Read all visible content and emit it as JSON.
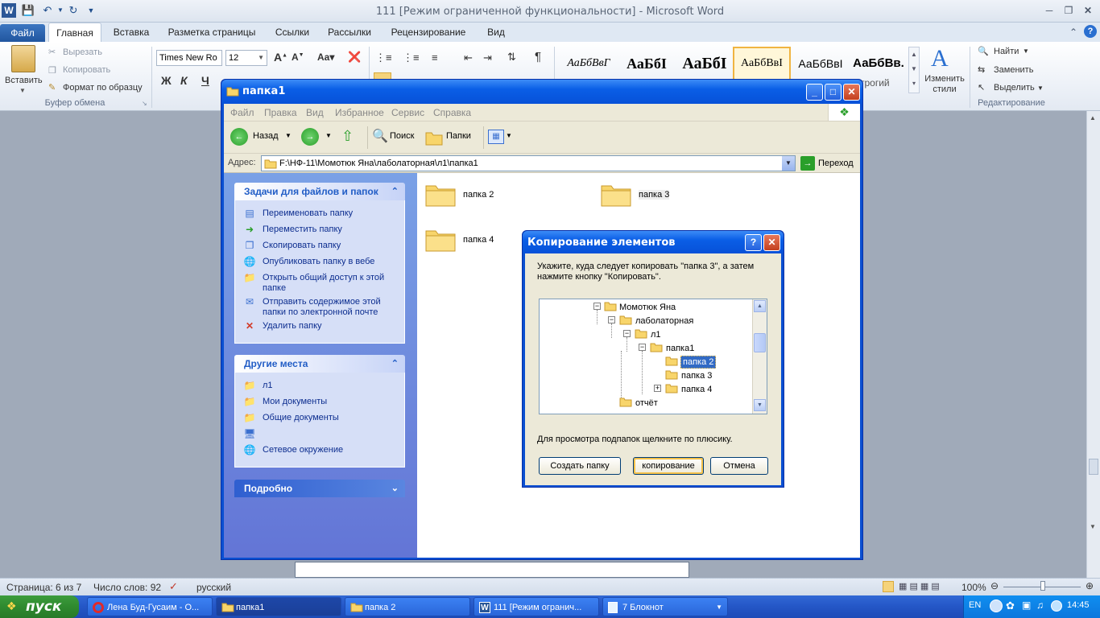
{
  "word": {
    "title": "111 [Режим ограниченной функциональности]  -  Microsoft Word",
    "tabs": [
      "Файл",
      "Главная",
      "Вставка",
      "Разметка страницы",
      "Ссылки",
      "Рассылки",
      "Рецензирование",
      "Вид"
    ],
    "clipboard": {
      "paste": "Вставить",
      "cut": "Вырезать",
      "copy": "Копировать",
      "format_painter": "Формат по образцу",
      "group": "Буфер обмена"
    },
    "font": {
      "name": "Times New Ro",
      "size": "12",
      "bold": "Ж",
      "italic": "К",
      "underline": "Ч"
    },
    "styles": [
      "АаБбВвГ",
      "АаБбI",
      "АаБбI",
      "АаБбВвI",
      "АаБбВвI",
      "АаБбВв."
    ],
    "styles_partial": "трогий",
    "change_styles": "Изменить стили",
    "editing": {
      "find": "Найти",
      "replace": "Заменить",
      "select": "Выделить",
      "group": "Редактирование"
    },
    "status": {
      "page": "Страница: 6 из 7",
      "words": "Число слов: 92",
      "lang": "русский",
      "zoom": "100%"
    }
  },
  "explorer": {
    "title": "папка1",
    "menu": [
      "Файл",
      "Правка",
      "Вид",
      "Избранное",
      "Сервис",
      "Справка"
    ],
    "toolbar": {
      "back": "Назад",
      "search": "Поиск",
      "folders": "Папки"
    },
    "address_label": "Адрес:",
    "address": "F:\\НФ-11\\Момотюк Яна\\лаболаторная\\л1\\папка1",
    "go": "Переход",
    "tasks_header": "Задачи для файлов и папок",
    "tasks": [
      "Переименовать папку",
      "Переместить папку",
      "Скопировать папку",
      "Опубликовать папку в вебе",
      "Открыть общий доступ к этой папке",
      "Отправить содержимое этой папки по электронной почте",
      "Удалить папку"
    ],
    "places_header": "Другие места",
    "places": [
      "л1",
      "Мои документы",
      "Общие документы",
      "",
      "Сетевое окружение"
    ],
    "details_header": "Подробно",
    "items": [
      "папка 2",
      "папка 3",
      "папка 4"
    ]
  },
  "dialog": {
    "title": "Копирование элементов",
    "instruction": "Укажите, куда следует копировать \"папка 3\", а затем нажмите кнопку \"Копировать\".",
    "tree": [
      "Момотюк Яна",
      "лаболаторная",
      "л1",
      "папка1",
      "папка 2",
      "папка 3",
      "папка 4",
      "отчёт"
    ],
    "hint": "Для просмотра подпапок щелкните по плюсику.",
    "buttons": {
      "new_folder": "Создать папку",
      "copy": "копирование",
      "cancel": "Отмена"
    }
  },
  "taskbar": {
    "start": "пуск",
    "items": [
      "Лена Буд-Гусаим - О...",
      "папка1",
      "папка 2",
      "111 [Режим огранич...",
      "7 Блокнот"
    ],
    "lang": "EN",
    "time": "14:45"
  }
}
